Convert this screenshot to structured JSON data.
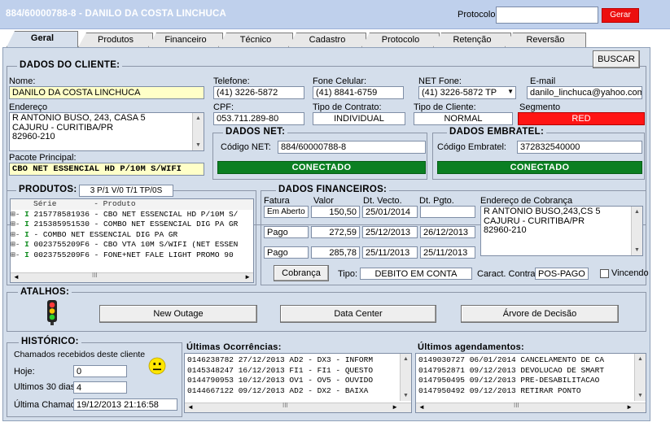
{
  "window": {
    "title": "884/60000788-8 - DANILO DA COSTA LINCHUCA",
    "protocolo_label": "Protocolo",
    "protocolo_value": "",
    "gerar_label": "Gerar"
  },
  "tabs": [
    "Geral",
    "Produtos",
    "Financeiro",
    "Técnico",
    "Cadastro",
    "Protocolo",
    "Retenção",
    "Reversão"
  ],
  "cliente": {
    "section_title": "DADOS DO CLIENTE:",
    "buscar_label": "BUSCAR",
    "nome_label": "Nome:",
    "nome": "DANILO DA COSTA LINCHUCA",
    "telefone_label": "Telefone:",
    "telefone": "(41) 3226-5872",
    "celular_label": "Fone Celular:",
    "celular": "(41) 8841-6759",
    "netfone_label": "NET Fone:",
    "netfone": "(41) 3226-5872 TP",
    "email_label": "E-mail",
    "email": "danilo_linchuca@yahoo.com.br",
    "endereco_label": "Endereço",
    "endereco_1": "R ANTONIO BUSO,   243,  CASA 5",
    "endereco_2": "CAJURU - CURITIBA/PR",
    "endereco_3": "82960-210",
    "cpf_label": "CPF:",
    "cpf": "053.711.289-80",
    "contrato_label": "Tipo de Contrato:",
    "contrato": "INDIVIDUAL",
    "tipo_cliente_label": "Tipo de Cliente:",
    "tipo_cliente": "NORMAL",
    "segmento_label": "Segmento",
    "segmento": "RED",
    "pacote_label": "Pacote Principal:",
    "pacote": "CBO NET ESSENCIAL HD P/10M S/WIFI"
  },
  "net": {
    "title": "DADOS NET:",
    "codigo_label": "Código NET:",
    "codigo": "884/60000788-8",
    "status": "CONECTADO"
  },
  "embratel": {
    "title": "DADOS EMBRATEL:",
    "codigo_label": "Código Embratel:",
    "codigo": "372832540000",
    "status": "CONECTADO"
  },
  "produtos": {
    "title": "PRODUTOS:",
    "summary": "3 P/1 V/0 T/1 TP/0S",
    "col_serie": "Série",
    "col_produto": "- Produto",
    "rows": [
      "215778581936 - CBO NET ESSENCIAL HD P/10M S/",
      "215385951530 - COMBO NET ESSENCIAL DIG PA GR",
      "             - COMBO NET ESSENCIAL DIG PA GR",
      "0023755209F6 - CBO VTA 10M S/WIFI (NET ESSEN",
      "0023755209F6 - FONE+NET FALE LIGHT PROMO 90"
    ]
  },
  "financeiro": {
    "title": "DADOS FINANCEIROS:",
    "col_fatura": "Fatura",
    "col_valor": "Valor",
    "col_vecto": "Dt. Vecto.",
    "col_pgto": "Dt. Pgto.",
    "col_endereco": "Endereço de Cobrança",
    "rows": [
      {
        "fatura": "Em Aberto",
        "valor": "150,50",
        "vecto": "25/01/2014",
        "pgto": ""
      },
      {
        "fatura": "Pago",
        "valor": "272,59",
        "vecto": "25/12/2013",
        "pgto": "26/12/2013"
      },
      {
        "fatura": "Pago",
        "valor": "285,78",
        "vecto": "25/11/2013",
        "pgto": "25/11/2013"
      }
    ],
    "cobranca_1": "R ANTONIO BUSO,243,CS 5",
    "cobranca_2": "CAJURU - CURITIBA/PR",
    "cobranca_3": "82960-210",
    "cobranca_button": "Cobrança",
    "tipo_label": "Tipo:",
    "tipo": "DEBITO EM CONTA",
    "caract_label": "Caract. Contrato:",
    "caract": "POS-PAGO",
    "vincendo_label": "Vincendo"
  },
  "atalhos": {
    "title": "ATALHOS:",
    "buttons": [
      "New Outage",
      "Data Center",
      "Árvore de Decisão"
    ]
  },
  "historico": {
    "title": "HISTÓRICO:",
    "subtitle": "Chamados recebidos deste cliente",
    "hoje_label": "Hoje:",
    "hoje": "0",
    "ultimos30_label": "Ultimos 30 dias:",
    "ultimos30": "4",
    "ultima_label": "Última Chamada:",
    "ultima": "19/12/2013 21:16:58"
  },
  "ocorrencias": {
    "title": "Últimas Ocorrências:",
    "rows": [
      "0146238782  27/12/2013  AD2 - DX3 - INFORM",
      "0145348247  16/12/2013  FI1 - FI1 - QUESTO",
      "0144790953  10/12/2013  OV1 - OV5 - OUVIDO",
      "0144667122  09/12/2013  AD2 - DX2 - BAIXA"
    ]
  },
  "agendamentos": {
    "title": "Últimos agendamentos:",
    "rows": [
      "0149030727  06/01/2014  CANCELAMENTO DE CA",
      "0147952871  09/12/2013  DEVOLUCAO DE SMART",
      "0147950495  09/12/2013  PRE-DESABILITACAO",
      "0147950492  09/12/2013  RETIRAR PONTO"
    ]
  },
  "colors": {
    "accent": "#bfd0ec",
    "panel": "#d4deeb",
    "connected": "#0b7f22",
    "segment_red": "#ff1414"
  }
}
